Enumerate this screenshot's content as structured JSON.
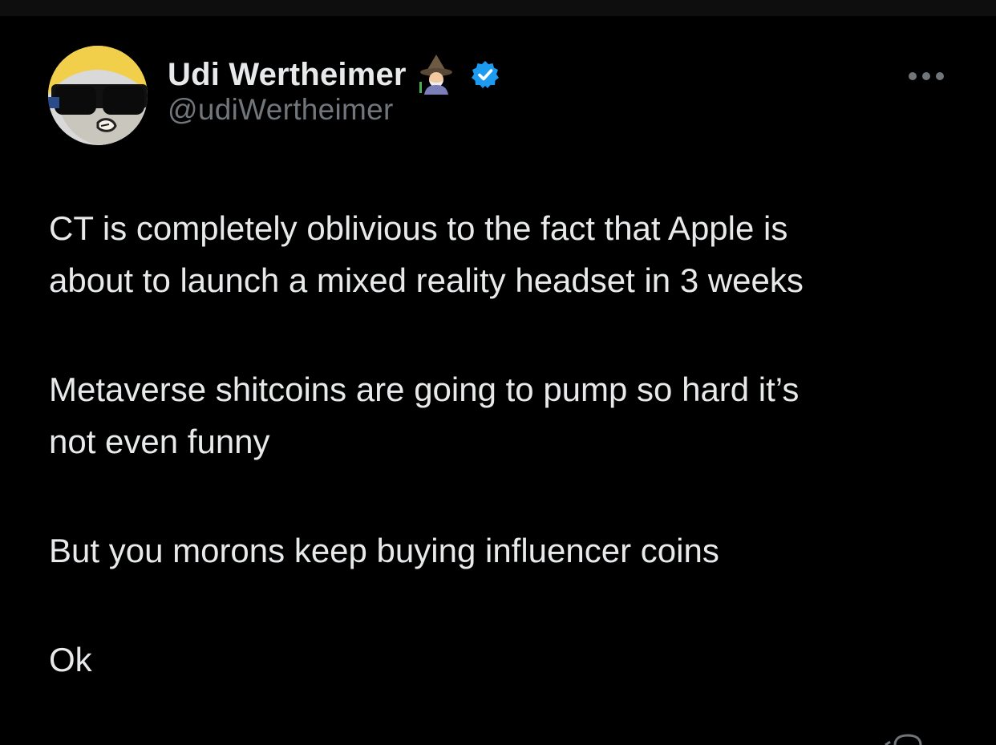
{
  "tweet": {
    "author": {
      "display_name": "Udi Wertheimer",
      "handle": "@udiWertheimer",
      "name_emoji": "mage-emoji-icon",
      "verified": true
    },
    "paragraphs": [
      "CT is completely oblivious to the fact that Apple is\nabout to launch a mixed reality headset in 3 weeks",
      "Metaverse shitcoins are going to pump so hard it’s\nnot even funny",
      "But you morons keep buying influencer coins",
      "Ok"
    ]
  },
  "colors": {
    "background": "#000000",
    "text_primary": "#e7e9ea",
    "text_secondary": "#71767b",
    "verified_blue": "#1d9bf0"
  }
}
